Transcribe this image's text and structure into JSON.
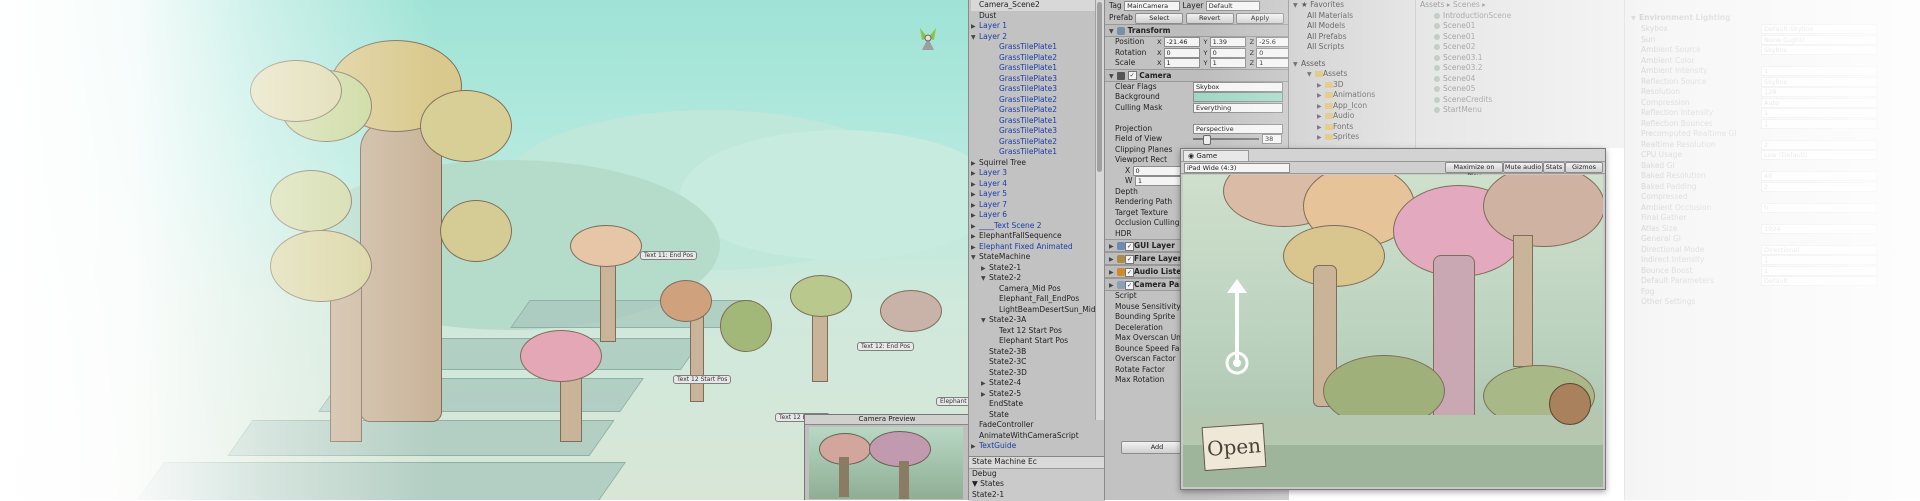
{
  "scene": {
    "labels": [
      "Text 11: End Pos",
      "Text 12: End Pos",
      "Text 12 Start Pos",
      "Text 12 End Pos",
      "Elephant"
    ],
    "camera_preview_title": "Camera Preview"
  },
  "hierarchy": {
    "items": [
      {
        "label": "Camera_Scene2",
        "indent": 0,
        "arrow": "",
        "blue": false
      },
      {
        "label": "Dust",
        "indent": 0,
        "arrow": "",
        "blue": false
      },
      {
        "label": "Layer 1",
        "indent": 0,
        "arrow": "▶",
        "blue": true
      },
      {
        "label": "Layer 2",
        "indent": 0,
        "arrow": "▼",
        "blue": true
      },
      {
        "label": "GrassTilePlate1",
        "indent": 2,
        "arrow": "",
        "blue": true
      },
      {
        "label": "GrassTilePlate2",
        "indent": 2,
        "arrow": "",
        "blue": true
      },
      {
        "label": "GrassTilePlate1",
        "indent": 2,
        "arrow": "",
        "blue": true
      },
      {
        "label": "GrassTilePlate3",
        "indent": 2,
        "arrow": "",
        "blue": true
      },
      {
        "label": "GrassTilePlate3",
        "indent": 2,
        "arrow": "",
        "blue": true
      },
      {
        "label": "GrassTilePlate2",
        "indent": 2,
        "arrow": "",
        "blue": true
      },
      {
        "label": "GrassTilePlate2",
        "indent": 2,
        "arrow": "",
        "blue": true
      },
      {
        "label": "GrassTilePlate1",
        "indent": 2,
        "arrow": "",
        "blue": true
      },
      {
        "label": "GrassTilePlate3",
        "indent": 2,
        "arrow": "",
        "blue": true
      },
      {
        "label": "GrassTilePlate2",
        "indent": 2,
        "arrow": "",
        "blue": true
      },
      {
        "label": "GrassTilePlate1",
        "indent": 2,
        "arrow": "",
        "blue": true
      },
      {
        "label": "Squirrel Tree",
        "indent": 0,
        "arrow": "▶",
        "blue": false
      },
      {
        "label": "Layer 3",
        "indent": 0,
        "arrow": "▶",
        "blue": true
      },
      {
        "label": "Layer 4",
        "indent": 0,
        "arrow": "▶",
        "blue": true
      },
      {
        "label": "Layer 5",
        "indent": 0,
        "arrow": "▶",
        "blue": true
      },
      {
        "label": "Layer 7",
        "indent": 0,
        "arrow": "▶",
        "blue": true
      },
      {
        "label": "Layer 6",
        "indent": 0,
        "arrow": "▶",
        "blue": true
      },
      {
        "label": "____Text Scene 2",
        "indent": 0,
        "arrow": "▶",
        "blue": true
      },
      {
        "label": "ElephantFallSequence",
        "indent": 0,
        "arrow": "▶",
        "blue": false
      },
      {
        "label": "Elephant Fixed Animated",
        "indent": 0,
        "arrow": "▶",
        "blue": true
      },
      {
        "label": "StateMachine",
        "indent": 0,
        "arrow": "▼",
        "blue": false
      },
      {
        "label": "State2-1",
        "indent": 1,
        "arrow": "▶",
        "blue": false
      },
      {
        "label": "State2-2",
        "indent": 1,
        "arrow": "▼",
        "blue": false
      },
      {
        "label": "Camera_Mid Pos",
        "indent": 2,
        "arrow": "",
        "blue": false
      },
      {
        "label": "Elephant_Fall_EndPos",
        "indent": 2,
        "arrow": "",
        "blue": false
      },
      {
        "label": "LightBeamDesertSun_Mid",
        "indent": 2,
        "arrow": "",
        "blue": false
      },
      {
        "label": "State2-3A",
        "indent": 1,
        "arrow": "▼",
        "blue": false
      },
      {
        "label": "Text 12 Start Pos",
        "indent": 2,
        "arrow": "",
        "blue": false
      },
      {
        "label": "Elephant Start Pos",
        "indent": 2,
        "arrow": "",
        "blue": false
      },
      {
        "label": "State2-3B",
        "indent": 1,
        "arrow": "",
        "blue": false
      },
      {
        "label": "State2-3C",
        "indent": 1,
        "arrow": "",
        "blue": false
      },
      {
        "label": "State2-3D",
        "indent": 1,
        "arrow": "",
        "blue": false
      },
      {
        "label": "State2-4",
        "indent": 1,
        "arrow": "▶",
        "blue": false
      },
      {
        "label": "State2-5",
        "indent": 1,
        "arrow": "▶",
        "blue": false
      },
      {
        "label": "EndState",
        "indent": 1,
        "arrow": "",
        "blue": false
      },
      {
        "label": "State",
        "indent": 1,
        "arrow": "",
        "blue": false
      },
      {
        "label": "FadeController",
        "indent": 0,
        "arrow": "",
        "blue": false
      },
      {
        "label": "AnimateWithCameraScript",
        "indent": 0,
        "arrow": "",
        "blue": false
      },
      {
        "label": "TextGuide",
        "indent": 0,
        "arrow": "▶",
        "blue": true
      }
    ],
    "bottom_tab": "State Machine Ec",
    "bottom_rows": [
      "Debug",
      "▼ States",
      "State2-1"
    ]
  },
  "inspector": {
    "tag_label": "Tag",
    "tag_value": "MainCamera",
    "layer_label": "Layer",
    "layer_value": "Default",
    "prefab_label": "Prefab",
    "prefab_buttons": [
      "Select",
      "Revert",
      "Apply"
    ],
    "transform": {
      "title": "Transform",
      "rows": [
        {
          "label": "Position",
          "x": "-21.46",
          "y": "1.39",
          "z": "-25.6"
        },
        {
          "label": "Rotation",
          "x": "0",
          "y": "0",
          "z": "0"
        },
        {
          "label": "Scale",
          "x": "1",
          "y": "1",
          "z": "1"
        }
      ]
    },
    "camera": {
      "title": "Camera",
      "rows": [
        {
          "label": "Clear Flags",
          "value": "Skybox"
        },
        {
          "label": "Background",
          "value": ""
        },
        {
          "label": "Culling Mask",
          "value": "Everything"
        },
        {
          "label": "",
          "value": ""
        },
        {
          "label": "Projection",
          "value": "Perspective"
        },
        {
          "label": "Field of View",
          "value": ""
        },
        {
          "label": "Clipping Planes",
          "value": ""
        }
      ],
      "fov_value": "38",
      "viewport_label": "Viewport Rect",
      "vx": "0",
      "vw": "1",
      "tail_rows": [
        "Depth",
        "Rendering Path",
        "Target Texture",
        "Occlusion Culling",
        "HDR"
      ]
    },
    "components": [
      "GUI Layer",
      "Flare Layer",
      "Audio Listener",
      "Camera Pan"
    ],
    "script_rows": [
      "Script",
      "Mouse Sensitivity",
      "Bounding Sprite",
      "Deceleration",
      "Max Overscan Unit",
      "Bounce Speed Fact",
      "Overscan Factor",
      "Rotate Factor",
      "Max Rotation"
    ],
    "add_button": "Add"
  },
  "project": {
    "favorites_title": "Favorites",
    "favorites": [
      "All Materials",
      "All Models",
      "All Prefabs",
      "All Scripts"
    ],
    "assets_title": "Assets",
    "assets_tree": [
      "Assets",
      "3D",
      "Animations",
      "App_Icon",
      "Audio",
      "Fonts",
      "Sprites"
    ],
    "breadcrumb": [
      "Assets",
      "Scenes"
    ],
    "scenes": [
      "IntroductionScene",
      "Scene01",
      "Scene01",
      "Scene02",
      "Scene03.1",
      "Scene03.2",
      "Scene04",
      "Scene05",
      "SceneCredits",
      "StartMenu"
    ]
  },
  "lighting": {
    "title": "Environment Lighting",
    "rows": [
      "Skybox",
      "Sun",
      "Ambient Source",
      "Ambient Color",
      "Ambient Intensity",
      "Reflection Source",
      "Resolution",
      "Compression",
      "Reflection Intensity",
      "Reflection Bounces",
      "Precomputed Realtime GI",
      "Realtime Resolution",
      "CPU Usage",
      "Baked GI",
      "Baked Resolution",
      "Baked Padding",
      "Compressed",
      "Ambient Occlusion",
      "Final Gather",
      "Atlas Size",
      "General GI",
      "Directional Mode",
      "Indirect Intensity",
      "Bounce Boost",
      "Default Parameters",
      "Fog",
      "Other Settings"
    ],
    "values": [
      "Default-Skybox",
      "None (Light)",
      "Skybox",
      "",
      "1",
      "Skybox",
      "128",
      "Auto",
      "1",
      "1",
      "",
      "2",
      "Low (Default)",
      "",
      "40",
      "2",
      "",
      "0",
      "",
      "1024",
      "",
      "Directional",
      "1",
      "1",
      "Default",
      ""
    ]
  },
  "game": {
    "tab": "Game",
    "aspect": "iPad Wide (4:3)",
    "toolbar": [
      "Maximize on Play",
      "Mute audio",
      "Stats",
      "Gizmos"
    ],
    "sign_text": "Open"
  }
}
